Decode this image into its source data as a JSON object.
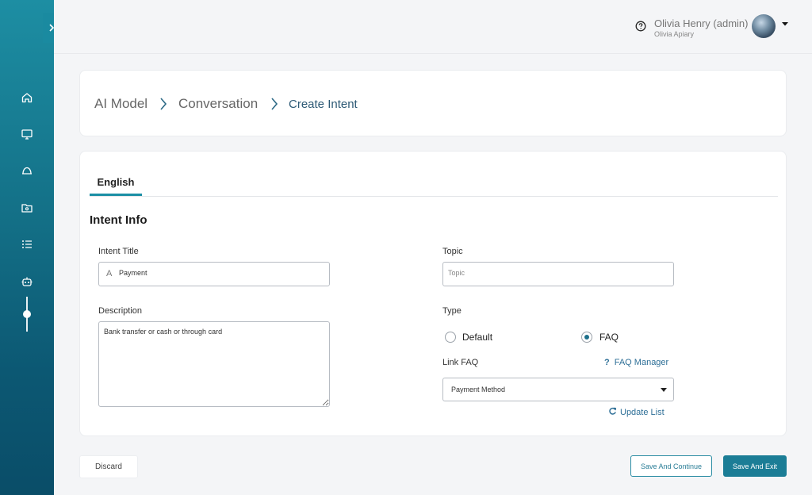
{
  "header": {
    "user_name": "Olivia Henry (admin)",
    "user_org": "Olivia Apiary"
  },
  "sidebar": {
    "items": [
      {
        "icon": "home-icon"
      },
      {
        "icon": "monitor-icon"
      },
      {
        "icon": "bell-icon"
      },
      {
        "icon": "folder-icon"
      },
      {
        "icon": "list-icon"
      },
      {
        "icon": "bot-icon"
      }
    ]
  },
  "breadcrumb": {
    "items": [
      "AI Model",
      "Conversation",
      "Create Intent"
    ]
  },
  "tabs": [
    {
      "label": "English",
      "active": true
    }
  ],
  "form": {
    "section_title": "Intent Info",
    "intent_title": {
      "label": "Intent Title",
      "prefix": "A",
      "value": "Payment"
    },
    "topic": {
      "label": "Topic",
      "value": "",
      "placeholder": "Topic"
    },
    "description": {
      "label": "Description",
      "value": "Bank transfer or cash or through card"
    },
    "type": {
      "label": "Type",
      "options": [
        {
          "label": "Default",
          "checked": false
        },
        {
          "label": "FAQ",
          "checked": true
        }
      ]
    },
    "link_faq": {
      "label": "Link FAQ",
      "value": "Payment Method",
      "manager_link": "FAQ Manager",
      "update_link": "Update List"
    }
  },
  "footer": {
    "discard": "Discard",
    "save_continue": "Save And Continue",
    "save_exit": "Save And Exit"
  },
  "colors": {
    "accent": "#1b7d96",
    "sidebar": "#136f86",
    "link": "#2e6f97"
  }
}
